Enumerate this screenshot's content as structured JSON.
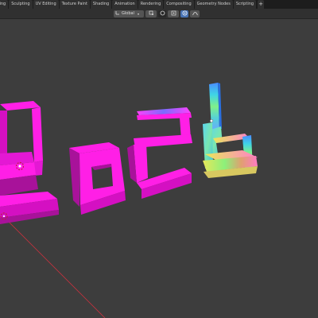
{
  "workspace_tabs": [
    {
      "label": "Modeling",
      "display": "eling",
      "active": false
    },
    {
      "label": "Sculpting",
      "display": "Sculpting",
      "active": false
    },
    {
      "label": "UV Editing",
      "display": "UV Editing",
      "active": false
    },
    {
      "label": "Texture Paint",
      "display": "Texture Paint",
      "active": false
    },
    {
      "label": "Shading",
      "display": "Shading",
      "active": false
    },
    {
      "label": "Animation",
      "display": "Animation",
      "active": false
    },
    {
      "label": "Rendering",
      "display": "Rendering",
      "active": false
    },
    {
      "label": "Compositing",
      "display": "Compositing",
      "active": false
    },
    {
      "label": "Geometry Nodes",
      "display": "Geometry Nodes",
      "active": false
    },
    {
      "label": "Scripting",
      "display": "Scripting",
      "active": false
    }
  ],
  "add_tab_label": "+",
  "viewport_header": {
    "orientation": "Global",
    "icons": [
      "orientation-icon",
      "pivot-point-icon",
      "snap-icon",
      "snap-target-icon",
      "proportional-editing-icon",
      "falloff-icon"
    ]
  },
  "scene": {
    "text_object": "2026",
    "material_colors": {
      "magenta": "#ff1fe6",
      "magenta_side": "#d410c2",
      "magenta_dark": "#a8129a",
      "normal_gradient": [
        "#4a8cff",
        "#33d6d0",
        "#7cf07a",
        "#e8e85a",
        "#ff7ac4"
      ]
    },
    "world_axis_color": "#c8323e"
  }
}
